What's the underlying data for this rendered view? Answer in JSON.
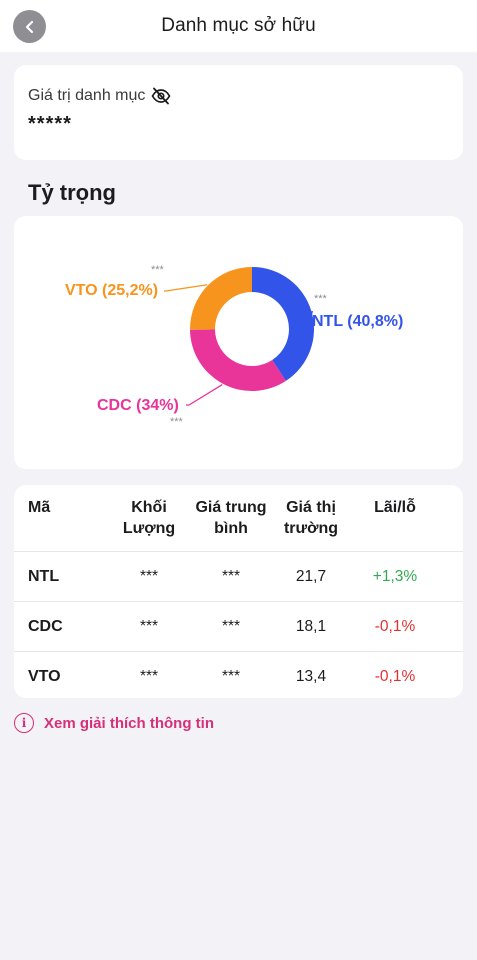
{
  "header": {
    "title": "Danh mục sở hữu",
    "back_icon": "chevron-left-icon"
  },
  "portfolio_value": {
    "label": "Giá trị danh mục",
    "masked_value": "*****",
    "visibility_icon": "eye-off-icon"
  },
  "allocation": {
    "title": "Tỷ trọng"
  },
  "chart_data": {
    "type": "pie",
    "donut": true,
    "slices": [
      {
        "label": "NTL (40,8%)",
        "code": "NTL",
        "value": 40.8,
        "color": "#3354e8",
        "hidden_value": "***"
      },
      {
        "label": "CDC (34%)",
        "code": "CDC",
        "value": 34.0,
        "color": "#e9349a",
        "hidden_value": "***"
      },
      {
        "label": "VTO (25,2%)",
        "code": "VTO",
        "value": 25.2,
        "color": "#f7941d",
        "hidden_value": "***"
      }
    ]
  },
  "table": {
    "headers": {
      "code": "Mã",
      "volume_1": "Khối",
      "volume_2": "Lượng",
      "avg_1": "Giá trung",
      "avg_2": "bình",
      "market_1": "Giá thị",
      "market_2": "trường",
      "pnl": "Lãi/lỗ"
    },
    "rows": [
      {
        "code": "NTL",
        "volume": "***",
        "avg_price": "***",
        "market_price": "21,7",
        "pnl": "+1,3%"
      },
      {
        "code": "CDC",
        "volume": "***",
        "avg_price": "***",
        "market_price": "18,1",
        "pnl": "-0,1%"
      },
      {
        "code": "VTO",
        "volume": "***",
        "avg_price": "***",
        "market_price": "13,4",
        "pnl": "-0,1%"
      }
    ]
  },
  "info_link": {
    "label": "Xem giải thích thông tin",
    "icon": "info-icon"
  },
  "colors": {
    "accent": "#d6307a",
    "positive": "#34a853",
    "negative": "#e03131"
  }
}
